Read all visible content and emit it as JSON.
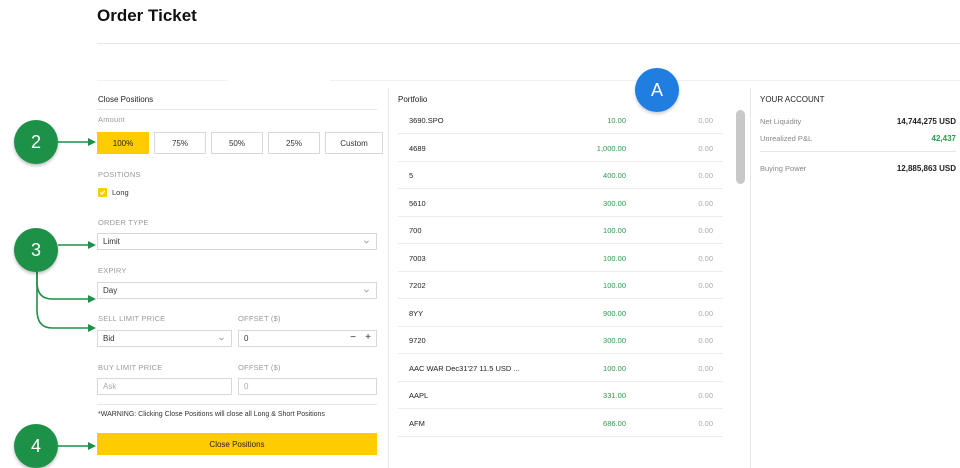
{
  "page": {
    "title": "Order Ticket"
  },
  "close_positions": {
    "section_title": "Close Positions",
    "amount_label": "Amount",
    "amount_options": [
      "100%",
      "75%",
      "50%",
      "25%",
      "Custom"
    ],
    "selected_amount": "100%",
    "positions_label": "POSITIONS",
    "long_label": "Long",
    "order_type_label": "ORDER TYPE",
    "order_type_value": "Limit",
    "expiry_label": "EXPIRY",
    "expiry_value": "Day",
    "sell_limit_label": "SELL LIMIT PRICE",
    "sell_limit_value": "Bid",
    "sell_offset_label": "OFFSET ($)",
    "sell_offset_value": "0",
    "stepper_minus": "−",
    "stepper_plus": "+",
    "buy_limit_label": "BUY LIMIT PRICE",
    "buy_limit_placeholder": "Ask",
    "buy_offset_label": "OFFSET ($)",
    "buy_offset_placeholder": "0",
    "warning": "*WARNING: Clicking Close Positions will close all Long & Short Positions",
    "close_button": "Close Positions"
  },
  "portfolio": {
    "title": "Portfolio",
    "rows": [
      {
        "symbol": "3690.SPO",
        "qty": "10.00",
        "value": "0.00"
      },
      {
        "symbol": "4689",
        "qty": "1,000.00",
        "value": "0.00"
      },
      {
        "symbol": "5",
        "qty": "400.00",
        "value": "0.00"
      },
      {
        "symbol": "5610",
        "qty": "300.00",
        "value": "0.00"
      },
      {
        "symbol": "700",
        "qty": "100.00",
        "value": "0.00"
      },
      {
        "symbol": "7003",
        "qty": "100.00",
        "value": "0.00"
      },
      {
        "symbol": "7202",
        "qty": "100.00",
        "value": "0.00"
      },
      {
        "symbol": "8YY",
        "qty": "900.00",
        "value": "0.00"
      },
      {
        "symbol": "9720",
        "qty": "300.00",
        "value": "0.00"
      },
      {
        "symbol": "AAC WAR Dec31'27 11.5 USD ...",
        "qty": "100.00",
        "value": "0.00"
      },
      {
        "symbol": "AAPL",
        "qty": "331.00",
        "value": "0.00"
      },
      {
        "symbol": "AFM",
        "qty": "686.00",
        "value": "0.00"
      }
    ]
  },
  "account": {
    "title": "YOUR ACCOUNT",
    "net_liquidity_label": "Net Liquidity",
    "net_liquidity_value": "14,744,275 USD",
    "unrealized_label": "Unrealized P&L",
    "unrealized_value": "42,437",
    "buying_power_label": "Buying Power",
    "buying_power_value": "12,885,863 USD"
  },
  "callouts": {
    "a": "A",
    "two": "2",
    "three": "3",
    "four": "4"
  },
  "colors": {
    "accent": "#ffcc00",
    "callout_green": "#1e9148",
    "callout_blue": "#1f7ee0",
    "positive": "#2e9a49"
  }
}
